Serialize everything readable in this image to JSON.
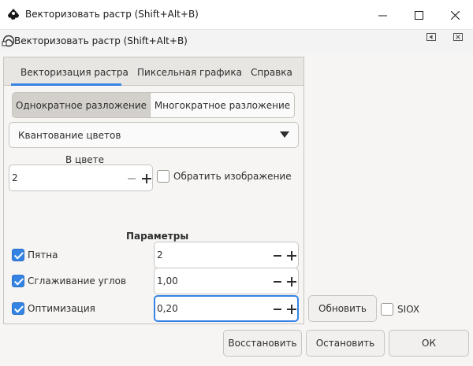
{
  "window": {
    "title": "Векторизовать растр (Shift+Alt+B)"
  },
  "dock": {
    "title": "Векторизовать растр (Shift+Alt+B)"
  },
  "tabs": [
    {
      "label": "Векторизация растра",
      "active": true
    },
    {
      "label": "Пиксельная графика",
      "active": false
    },
    {
      "label": "Справка",
      "active": false
    }
  ],
  "mode": {
    "single": "Однократное разложение",
    "multi": "Многократное разложение",
    "selected": "single"
  },
  "method": {
    "selected": "Квантование цветов"
  },
  "colors": {
    "label": "В цвете",
    "value": "2"
  },
  "invert": {
    "label": "Обратить изображение",
    "checked": false
  },
  "params": {
    "heading": "Параметры",
    "speckles": {
      "label": "Пятна",
      "checked": true,
      "value": "2"
    },
    "smooth": {
      "label": "Сглаживание углов",
      "checked": true,
      "value": "1,00"
    },
    "optimize": {
      "label": "Оптимизация",
      "checked": true,
      "value": "0,20"
    }
  },
  "preview": {
    "update_label": "Обновить",
    "siox_label": "SIOX",
    "siox_checked": false
  },
  "actions": {
    "reset": "Восстановить",
    "stop": "Остановить",
    "ok": "ОК"
  },
  "colors_theme": {
    "accent": "#3584e4",
    "panel_bg": "#f6f5f4"
  }
}
